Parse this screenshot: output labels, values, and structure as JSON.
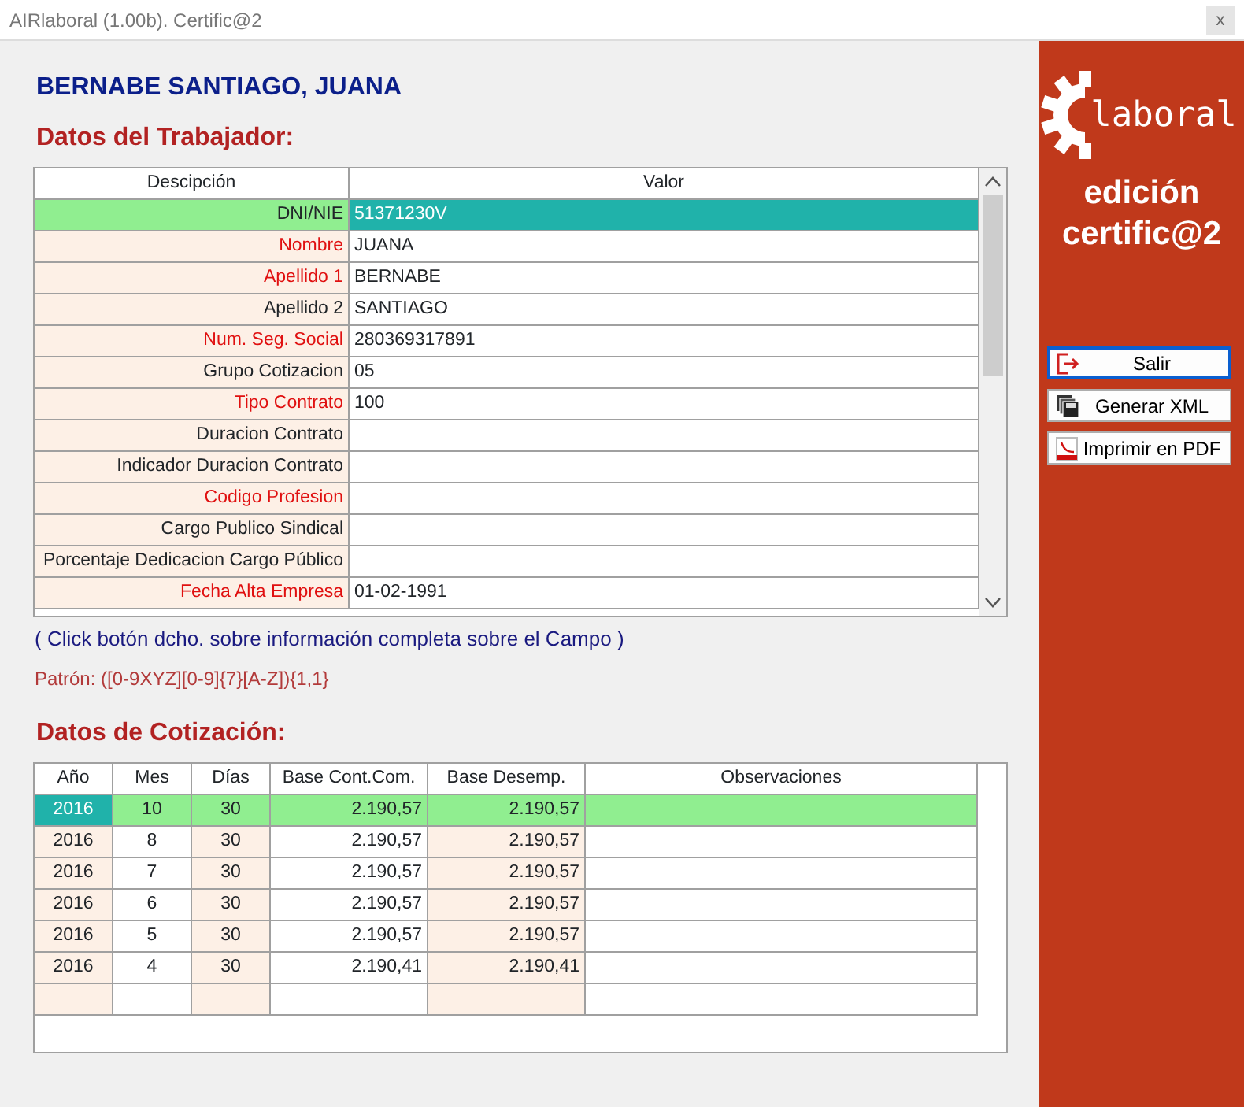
{
  "window": {
    "title": "AIRlaboral (1.00b). Certific@2",
    "close": "x"
  },
  "worker_name": "BERNABE SANTIAGO, JUANA",
  "worker_section": {
    "title": "Datos del Trabajador:",
    "columns": [
      "Descipción",
      "Valor"
    ],
    "rows": [
      {
        "label": "DNI/NIE",
        "value": "51371230V",
        "required": false,
        "selected": true
      },
      {
        "label": "Nombre",
        "value": "JUANA",
        "required": true,
        "selected": false
      },
      {
        "label": "Apellido 1",
        "value": "BERNABE",
        "required": true,
        "selected": false
      },
      {
        "label": "Apellido 2",
        "value": "SANTIAGO",
        "required": false,
        "selected": false
      },
      {
        "label": "Num. Seg. Social",
        "value": "280369317891",
        "required": true,
        "selected": false
      },
      {
        "label": "Grupo Cotizacion",
        "value": "05",
        "required": false,
        "selected": false
      },
      {
        "label": "Tipo Contrato",
        "value": "100",
        "required": true,
        "selected": false
      },
      {
        "label": "Duracion Contrato",
        "required": false,
        "selected": false
      },
      {
        "label": "Indicador Duracion Contrato",
        "required": false,
        "selected": false
      },
      {
        "label": "Codigo Profesion",
        "required": true,
        "selected": false
      },
      {
        "label": "Cargo Publico Sindical",
        "required": false,
        "selected": false
      },
      {
        "label": "Porcentaje Dedicacion Cargo Público",
        "required": false,
        "selected": false
      },
      {
        "label": "Fecha Alta Empresa",
        "value": "01-02-1991",
        "required": true,
        "selected": false
      }
    ],
    "hint": "( Click botón dcho. sobre información completa sobre el Campo )",
    "pattern": "Patrón: ([0-9XYZ][0-9]{7}[A-Z]){1,1}"
  },
  "contribution_section": {
    "title": "Datos de Cotización:",
    "columns": [
      "Año",
      "Mes",
      "Días",
      "Base Cont.Com.",
      "Base Desemp.",
      "Observaciones"
    ],
    "rows": [
      {
        "cells": [
          "2016",
          "10",
          "30",
          "2.190,57",
          "2.190,57"
        ],
        "selected": true
      },
      {
        "cells": [
          "2016",
          "8",
          "30",
          "2.190,57",
          "2.190,57"
        ],
        "selected": false
      },
      {
        "cells": [
          "2016",
          "7",
          "30",
          "2.190,57",
          "2.190,57"
        ],
        "selected": false
      },
      {
        "cells": [
          "2016",
          "6",
          "30",
          "2.190,57",
          "2.190,57"
        ],
        "selected": false
      },
      {
        "cells": [
          "2016",
          "5",
          "30",
          "2.190,57",
          "2.190,57"
        ],
        "selected": false
      },
      {
        "cells": [
          "2016",
          "4",
          "30",
          "2.190,41",
          "2.190,41"
        ],
        "selected": false
      }
    ]
  },
  "sidebar": {
    "logo_text": "laboral",
    "edition": [
      "edición",
      "certific@2"
    ],
    "buttons": [
      {
        "label": "Salir",
        "kind": "exit",
        "focused": true
      },
      {
        "label": "Generar XML",
        "kind": "xml",
        "focused": false
      },
      {
        "label": "Imprimir en PDF",
        "kind": "pdf",
        "focused": false
      }
    ]
  }
}
